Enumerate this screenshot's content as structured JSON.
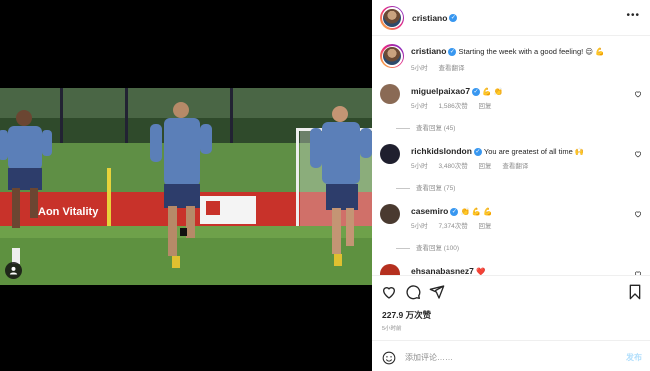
{
  "post": {
    "username": "cristiano",
    "more_icon": "more-horizontal-icon"
  },
  "caption": {
    "username": "cristiano",
    "text": "Starting the week with a good feeling! 😌 💪",
    "time": "5小时",
    "translate": "查看翻译"
  },
  "comments": [
    {
      "username": "miguelpaixao7",
      "text": "💪 👏",
      "time": "5小时",
      "likes": "1,586次赞",
      "reply": "回复",
      "view_replies": "查看回复 (45)",
      "avatar_color": "#8a6a55"
    },
    {
      "username": "richkidslondon",
      "text": "You are greatest of all time 🙌",
      "time": "5小时",
      "likes": "3,480次赞",
      "reply": "回复",
      "translate": "查看翻译",
      "view_replies": "查看回复 (75)",
      "avatar_color": "#1f1f2e"
    },
    {
      "username": "casemiro",
      "text": "👏 💪 💪",
      "time": "5小时",
      "likes": "7,374次赞",
      "reply": "回复",
      "view_replies": "查看回复 (100)",
      "avatar_color": "#4a3a30"
    },
    {
      "username": "ehsanabasnez7",
      "text": "❤️",
      "avatar_color": "#b5301f"
    }
  ],
  "actions": {
    "likes": "227.9 万次赞",
    "time": "5小时前"
  },
  "add_comment": {
    "placeholder": "添加评论……",
    "post_label": "发布"
  },
  "photo": {
    "banner_text": "Aon Vitality",
    "players": [
      {
        "shirt": "#5b7fb8"
      },
      {
        "shirt": "#5b7fb8"
      },
      {
        "shirt": "#5b7fb8"
      }
    ]
  },
  "colors": {
    "verified": "#3897f0",
    "link": "#0095f6",
    "muted": "#8e8e8e",
    "post_disabled": "#b2dffc"
  }
}
